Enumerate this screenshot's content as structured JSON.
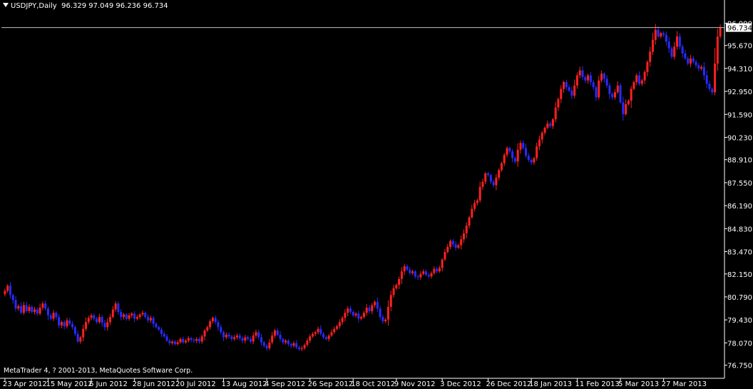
{
  "header": {
    "symbol": "USDJPY,Daily",
    "ohlc": "96.329 97.049 96.236 96.734"
  },
  "copyright": "MetaTrader 4, ? 2001-2013, MetaQuotes Software Corp.",
  "colors": {
    "background": "#000000",
    "bull": "#ff2020",
    "bear": "#2a2aff",
    "axis": "#ffffff",
    "price_line": "#c0c0c0"
  },
  "chart_data": {
    "type": "candlestick",
    "title": "USDJPY,Daily",
    "grid": false,
    "ylim": [
      76.1,
      97.6
    ],
    "y_ticks": [
      "96.990",
      "95.670",
      "94.310",
      "92.950",
      "91.590",
      "90.230",
      "88.910",
      "87.550",
      "86.190",
      "84.830",
      "83.470",
      "82.150",
      "80.790",
      "79.430",
      "78.070",
      "76.750"
    ],
    "x_ticks": [
      "23 Apr 2012",
      "15 May 2012",
      "6 Jun 2012",
      "28 Jun 2012",
      "20 Jul 2012",
      "13 Aug 2012",
      "4 Sep 2012",
      "26 Sep 2012",
      "18 Oct 2012",
      "9 Nov 2012",
      "3 Dec 2012",
      "26 Dec 2012",
      "18 Jan 2013",
      "11 Feb 2013",
      "5 Mar 2013",
      "27 Mar 2013"
    ],
    "x_tick_bar_index": [
      0,
      16,
      32,
      48,
      64,
      81,
      97,
      113,
      129,
      145,
      162,
      179,
      195,
      212,
      228,
      244
    ],
    "current_price": "96.734",
    "closes": [
      81.15,
      81.45,
      80.9,
      80.6,
      80.1,
      80.25,
      79.85,
      80.3,
      79.95,
      80.2,
      79.9,
      80.05,
      79.8,
      80.15,
      80.4,
      80.1,
      79.7,
      79.5,
      79.85,
      79.6,
      79.1,
      79.3,
      79.05,
      79.4,
      79.2,
      79.0,
      78.6,
      78.15,
      78.4,
      78.9,
      79.3,
      79.55,
      79.7,
      79.5,
      79.3,
      79.6,
      79.25,
      79.0,
      79.3,
      79.6,
      80.05,
      80.4,
      79.9,
      79.6,
      79.75,
      79.5,
      79.7,
      79.8,
      79.5,
      79.6,
      79.75,
      79.85,
      79.6,
      79.4,
      79.55,
      79.2,
      79.0,
      78.85,
      78.6,
      78.45,
      78.2,
      78.05,
      78.15,
      78.0,
      78.1,
      78.3,
      78.1,
      78.2,
      78.35,
      78.25,
      78.2,
      78.3,
      78.15,
      78.45,
      78.8,
      79.0,
      79.35,
      79.55,
      79.3,
      79.0,
      78.7,
      78.4,
      78.55,
      78.45,
      78.3,
      78.4,
      78.5,
      78.35,
      78.2,
      78.4,
      78.3,
      78.15,
      78.5,
      78.7,
      78.4,
      78.1,
      77.9,
      77.75,
      78.1,
      78.5,
      78.8,
      78.55,
      78.3,
      78.1,
      78.2,
      78.0,
      77.9,
      78.05,
      77.8,
      77.7,
      77.75,
      77.95,
      78.2,
      78.45,
      78.6,
      78.7,
      78.9,
      78.6,
      78.4,
      78.3,
      78.5,
      78.7,
      78.9,
      79.05,
      79.3,
      79.55,
      79.85,
      80.1,
      79.9,
      79.7,
      79.8,
      79.5,
      79.6,
      79.85,
      80.15,
      79.95,
      80.3,
      80.5,
      80.1,
      79.6,
      79.35,
      79.45,
      80.2,
      80.9,
      81.3,
      81.5,
      81.85,
      82.3,
      82.6,
      82.4,
      82.2,
      82.3,
      82.0,
      81.95,
      82.15,
      82.3,
      82.1,
      82.0,
      82.2,
      82.45,
      82.3,
      82.5,
      83.0,
      83.45,
      83.75,
      84.1,
      83.9,
      83.7,
      83.85,
      84.2,
      84.55,
      85.0,
      85.5,
      86.0,
      86.35,
      86.5,
      87.3,
      87.6,
      88.1,
      88.0,
      87.6,
      87.4,
      87.85,
      88.3,
      88.7,
      89.2,
      89.6,
      89.4,
      89.0,
      88.8,
      89.5,
      89.9,
      89.6,
      89.15,
      88.9,
      88.75,
      89.0,
      89.7,
      90.1,
      90.5,
      90.8,
      91.05,
      90.9,
      91.3,
      92.0,
      92.5,
      93.1,
      93.5,
      93.2,
      93.0,
      92.7,
      93.3,
      93.9,
      94.2,
      93.8,
      93.6,
      93.9,
      93.5,
      93.2,
      92.6,
      93.6,
      94.0,
      93.7,
      93.3,
      92.8,
      92.6,
      92.9,
      93.3,
      92.3,
      91.6,
      92.2,
      92.4,
      93.1,
      93.5,
      93.9,
      93.4,
      93.6,
      94.1,
      94.7,
      95.3,
      96.0,
      96.6,
      96.2,
      96.4,
      96.3,
      95.9,
      95.5,
      95.0,
      95.6,
      96.2,
      95.6,
      95.2,
      94.9,
      94.6,
      94.9,
      94.7,
      94.5,
      94.3,
      94.4,
      93.9,
      93.4,
      93.1,
      92.9,
      94.6,
      96.2,
      96.73
    ]
  }
}
